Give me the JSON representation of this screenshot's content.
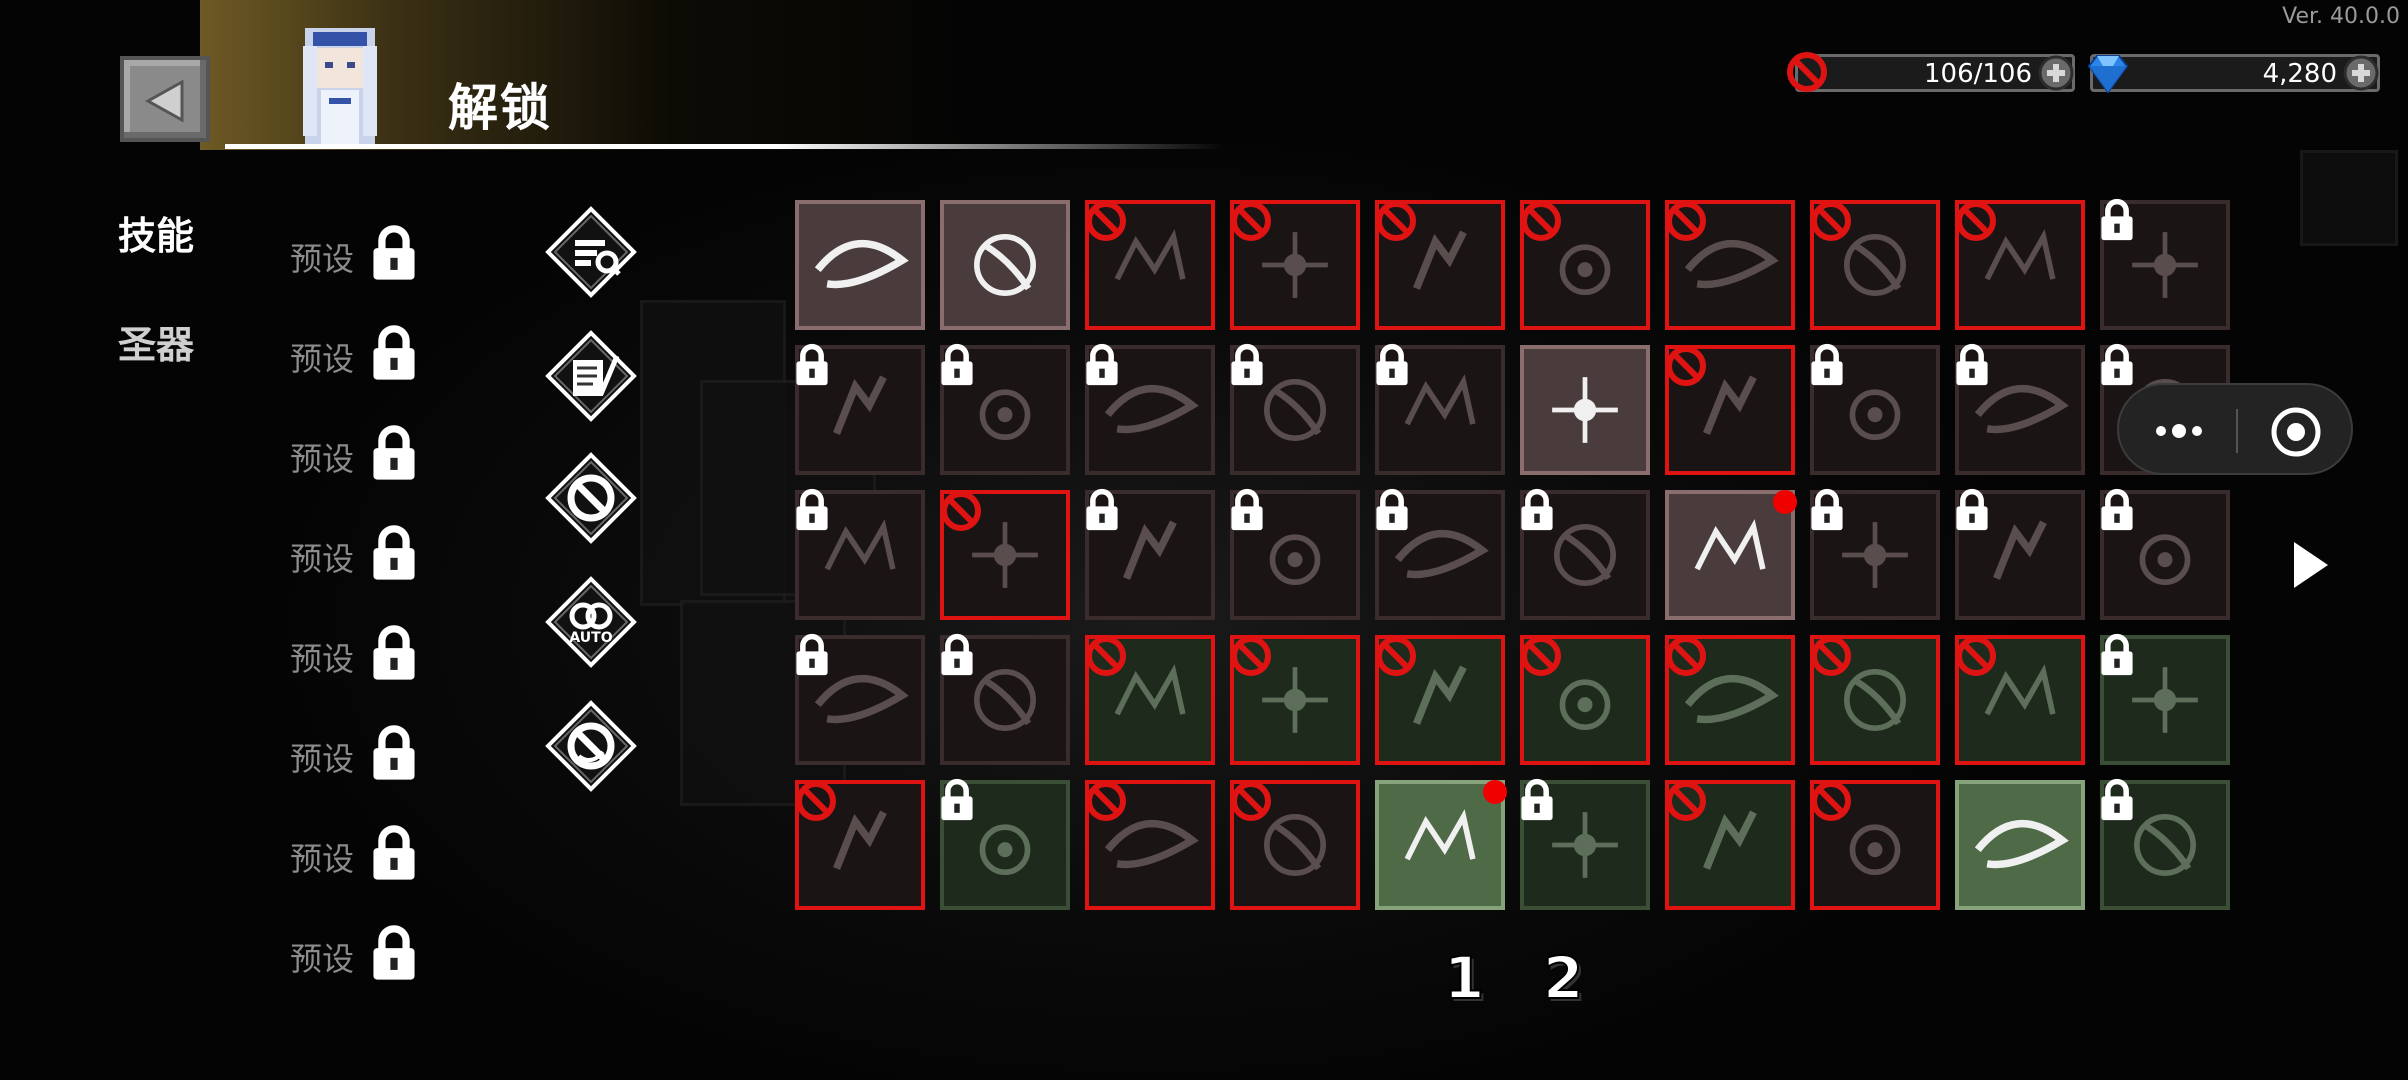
{
  "header": {
    "title": "解锁",
    "version": "Ver. 40.0.0"
  },
  "resources": {
    "stamina": {
      "value": "106/106",
      "icon": "ban-icon"
    },
    "gems": {
      "value": "4,280",
      "icon": "diamond-icon"
    }
  },
  "tabs": [
    {
      "label": "技能",
      "active": true
    },
    {
      "label": "圣器",
      "active": false
    }
  ],
  "presets": [
    {
      "label": "预设"
    },
    {
      "label": "预设"
    },
    {
      "label": "预设"
    },
    {
      "label": "预设"
    },
    {
      "label": "预设"
    },
    {
      "label": "预设"
    },
    {
      "label": "预设"
    },
    {
      "label": "预设"
    }
  ],
  "filters": [
    {
      "icon": "search-list-icon"
    },
    {
      "icon": "scroll-quill-icon"
    },
    {
      "icon": "ban-filter-icon"
    },
    {
      "icon": "auto-chain-icon"
    },
    {
      "icon": "ban-swirl-icon"
    }
  ],
  "grid": {
    "rows": [
      [
        "unlocked",
        "unlocked",
        "banned",
        "banned",
        "banned",
        "banned",
        "banned",
        "banned",
        "banned",
        "locked"
      ],
      [
        "locked",
        "locked",
        "locked",
        "locked",
        "locked",
        "unlocked",
        "banned",
        "locked",
        "locked",
        "locked"
      ],
      [
        "locked",
        "banned",
        "locked",
        "locked",
        "locked",
        "locked",
        "unlocked-new",
        "locked",
        "locked",
        "locked"
      ],
      [
        "locked",
        "locked",
        "banned-green",
        "banned-green",
        "banned-green",
        "banned-green",
        "banned-green",
        "banned-green",
        "banned-green",
        "locked-green"
      ],
      [
        "banned",
        "locked-green",
        "banned",
        "banned",
        "unlocked-green-new",
        "locked-green",
        "banned-green",
        "banned",
        "unlocked-green",
        "locked-green"
      ]
    ]
  },
  "pages": [
    "1",
    "2"
  ],
  "colors": {
    "banned_border": "#e01313",
    "unlocked_bg": "#4a3c3c",
    "green_bg": "#2f3f2d",
    "header_gold": "#6e5a24"
  }
}
